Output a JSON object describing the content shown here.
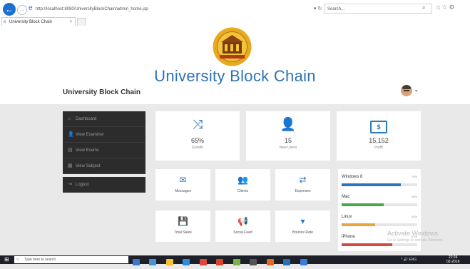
{
  "browser": {
    "address": "http://localhost:8080/UniversityBlockChain/admin_home.jsp",
    "address_tools": "▾ ↻",
    "search_placeholder": "Search...",
    "tab_title": "University Block Chain",
    "tab_close": "×"
  },
  "header": {
    "big_title": "University Block Chain",
    "brand": "University Block Chain",
    "caret": "▾"
  },
  "sidebar": {
    "items": [
      {
        "label": "Dashboard",
        "icon": "⌂"
      },
      {
        "label": "View Examiner",
        "icon": "👤"
      },
      {
        "label": "View Exams",
        "icon": "▤"
      },
      {
        "label": "View Subject",
        "icon": "▦"
      },
      {
        "label": "Logout",
        "icon": "⇥"
      }
    ]
  },
  "stats": [
    {
      "icon": "⤨",
      "value": "65%",
      "label": "Growth"
    },
    {
      "icon": "👤",
      "value": "15",
      "label": "New Users"
    },
    {
      "icon": "$",
      "value": "15,152",
      "label": "Profit"
    }
  ],
  "tiles": [
    {
      "icon": "✉",
      "label": "Messages"
    },
    {
      "icon": "👥",
      "label": "Clients"
    },
    {
      "icon": "⇄",
      "label": "Expenses"
    },
    {
      "icon": "💾",
      "label": "Total Sales"
    },
    {
      "icon": "📢",
      "label": "Social Feed"
    },
    {
      "icon": "▾",
      "label": "Bounce Rate"
    }
  ],
  "progress": [
    {
      "name": "Windows 8",
      "percent": 78,
      "label": "78%",
      "color": "#2a73c0"
    },
    {
      "name": "Mac",
      "percent": 56,
      "label": "56%",
      "color": "#4aa84a"
    },
    {
      "name": "Linux",
      "percent": 44,
      "label": "44%",
      "color": "#e8a33a"
    },
    {
      "name": "iPhone",
      "percent": 67,
      "label": "67%",
      "color": "#cf4b45"
    }
  ],
  "watermark": {
    "title": "Activate Windows",
    "subtitle": "Go to Settings to activate Windows."
  },
  "taskbar": {
    "search_placeholder": "Type here to search",
    "tray": "^ 🔊 ENG",
    "time": "22:24",
    "date": "02-2018"
  }
}
